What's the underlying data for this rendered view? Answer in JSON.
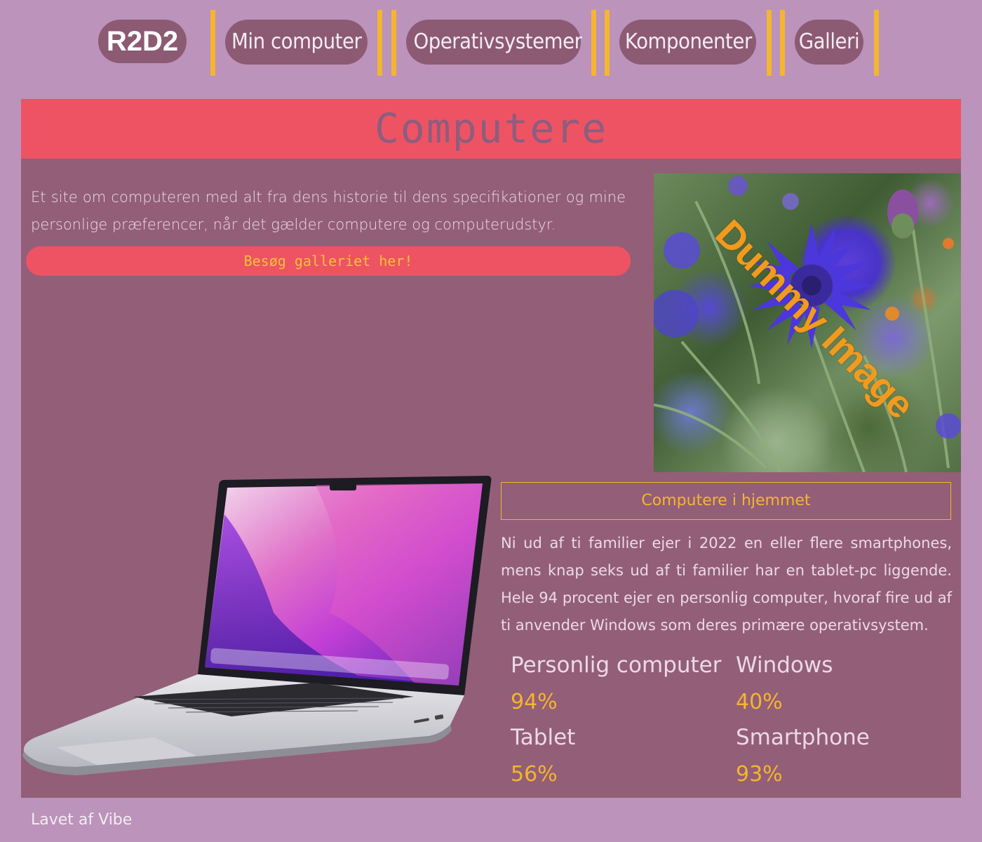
{
  "nav": {
    "logo": "R2D2",
    "items": [
      {
        "label": "Min computer"
      },
      {
        "label": "Operativsystemer"
      },
      {
        "label": "Komponenter"
      },
      {
        "label": "Galleri"
      }
    ],
    "accent_color": "#f5b52e"
  },
  "hero": {
    "title": "Computere"
  },
  "intro": {
    "text": "Et site om computeren med alt fra dens historie til dens specifikationer og mine personlige præferencer, når det gælder computere og computerudstyr.",
    "cta_label": "Besøg galleriet her!"
  },
  "image": {
    "placeholder_text": "Dummy Image"
  },
  "section": {
    "heading": "Computere i hjemmet",
    "body": "Ni ud af ti familier ejer i 2022 en eller flere smartphones, mens knap seks ud af ti familier har en tablet-pc liggende. Hele 94 procent ejer en personlig computer, hvoraf fire ud af ti anvender Windows som deres primære operativsystem."
  },
  "stats": [
    {
      "label": "Personlig computer",
      "value": "94%"
    },
    {
      "label": "Windows",
      "value": "40%"
    },
    {
      "label": "Tablet",
      "value": "56%"
    },
    {
      "label": "Smartphone",
      "value": "93%"
    }
  ],
  "footer": {
    "text": "Lavet af Vibe"
  },
  "colors": {
    "background": "#bb93bb",
    "panel": "#935e78",
    "hero": "#ee5363",
    "pill": "#8c5a73",
    "accent": "#f5b52e"
  }
}
